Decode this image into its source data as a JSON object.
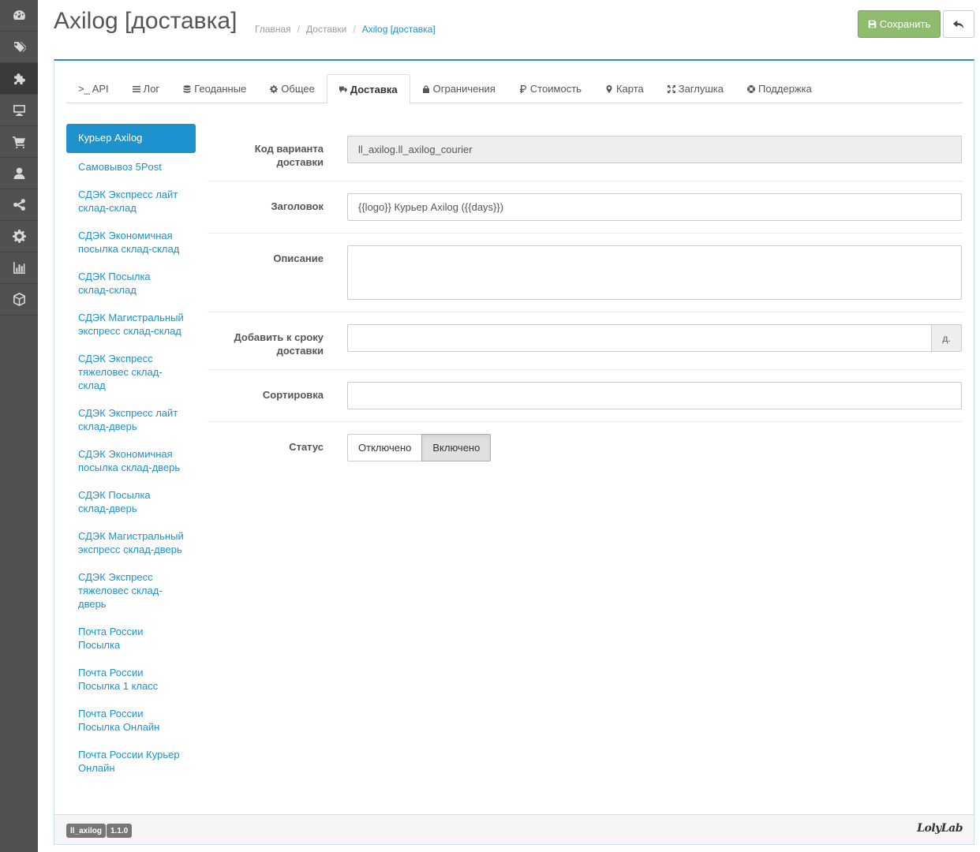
{
  "sidebar": {
    "items": [
      {
        "icon": "dashboard-icon"
      },
      {
        "icon": "tags-icon"
      },
      {
        "icon": "puzzle-icon",
        "active": true
      },
      {
        "icon": "monitor-icon"
      },
      {
        "icon": "cart-icon"
      },
      {
        "icon": "user-icon"
      },
      {
        "icon": "share-icon"
      },
      {
        "icon": "gear-icon"
      },
      {
        "icon": "bar-chart-icon"
      },
      {
        "icon": "cube-icon"
      }
    ]
  },
  "header": {
    "title": "Axilog [доставка]",
    "breadcrumb": [
      "Главная",
      "Доставки",
      "Axilog [доставка]"
    ],
    "save_label": "Сохранить"
  },
  "tabs": [
    {
      "label": ">_ API"
    },
    {
      "label": "Лог"
    },
    {
      "label": "Геоданные"
    },
    {
      "label": "Общее"
    },
    {
      "label": "Доставка",
      "active": true
    },
    {
      "label": "Ограничения"
    },
    {
      "label": "Стоимость"
    },
    {
      "label": "Карта"
    },
    {
      "label": "Заглушка"
    },
    {
      "label": "Поддержка"
    }
  ],
  "methods": [
    "Курьер Axilog",
    "Самовывоз 5Post",
    "СДЭК Экспресс лайт склад-склад",
    "СДЭК Экономичная посылка склад-склад",
    "СДЭК Посылка склад-склад",
    "СДЭК Магистральный экспресс склад-склад",
    "СДЭК Экспресс тяжеловес склад-склад",
    "СДЭК Экспресс лайт склад-дверь",
    "СДЭК Экономичная посылка склад-дверь",
    "СДЭК Посылка склад-дверь",
    "СДЭК Магистральный экспресс склад-дверь",
    "СДЭК Экспресс тяжеловес склад-дверь",
    "Почта России Посылка",
    "Почта России Посылка 1 класс",
    "Почта России Посылка Онлайн",
    "Почта России Курьер Онлайн"
  ],
  "form": {
    "code_label": "Код варианта доставки",
    "code_value": "ll_axilog.ll_axilog_courier",
    "title_label": "Заголовок",
    "title_value": "{{logo}} Курьер Axilog ({{days}})",
    "description_label": "Описание",
    "description_value": "",
    "add_days_label": "Добавить к сроку доставки",
    "add_days_value": "",
    "add_days_suffix": "д.",
    "sort_label": "Сортировка",
    "sort_value": "",
    "status_label": "Статус",
    "status_off": "Отключено",
    "status_on": "Включено"
  },
  "footer": {
    "module_badge": "ll_axilog",
    "version_badge": "1.1.0",
    "logo_text": "LolyLab"
  },
  "colors": {
    "accent": "#1e91cf",
    "save": "#8fbb6c",
    "sidebar": "#515151"
  }
}
